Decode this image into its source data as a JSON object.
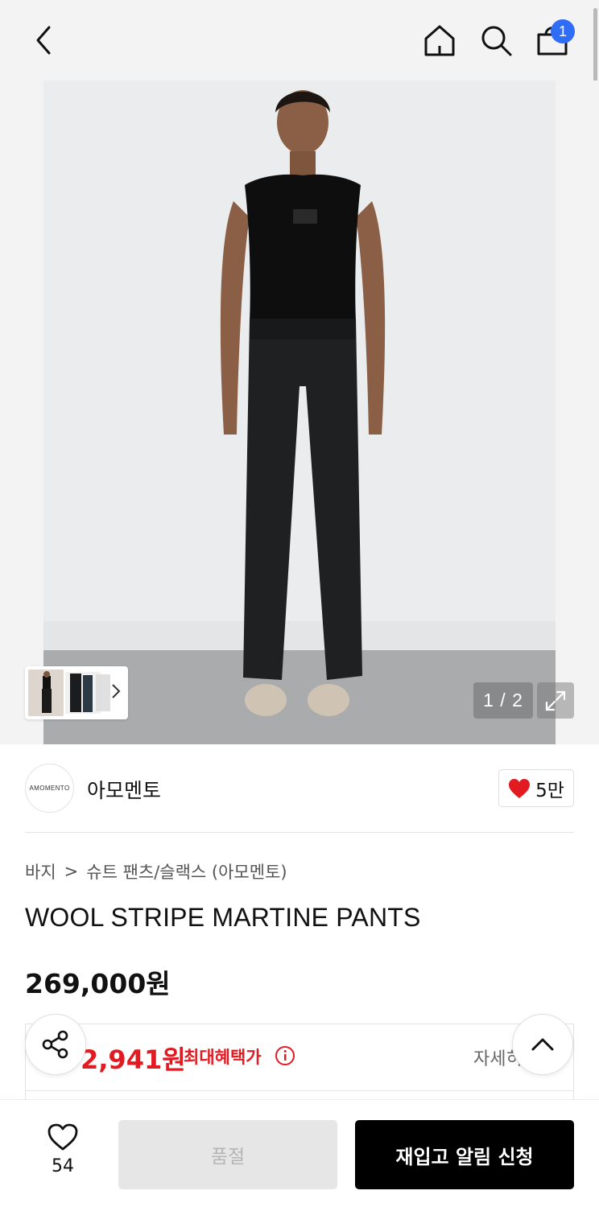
{
  "header": {
    "cart_count": "1"
  },
  "gallery": {
    "pager": "1 / 2"
  },
  "brand": {
    "logo_text": "AMOMENTO",
    "name": "아모멘토",
    "like_count": "5만"
  },
  "breadcrumb": {
    "category": "바지",
    "separator": ">",
    "subcategory": "슈트 팬츠/슬랙스 (아모멘토)"
  },
  "product": {
    "title": "WOOL STRIPE MARTINE PANTS",
    "price": "269,000원"
  },
  "benefit": {
    "price": "2,941원",
    "label": "최대혜택가",
    "details": "자세히"
  },
  "bottom_bar": {
    "wish_count": "54",
    "soldout_label": "품절",
    "restock_label": "재입고 알림 신청"
  },
  "colors": {
    "accent_red": "#e21b23",
    "badge_blue": "#2f6df6",
    "cta_black": "#000000"
  }
}
